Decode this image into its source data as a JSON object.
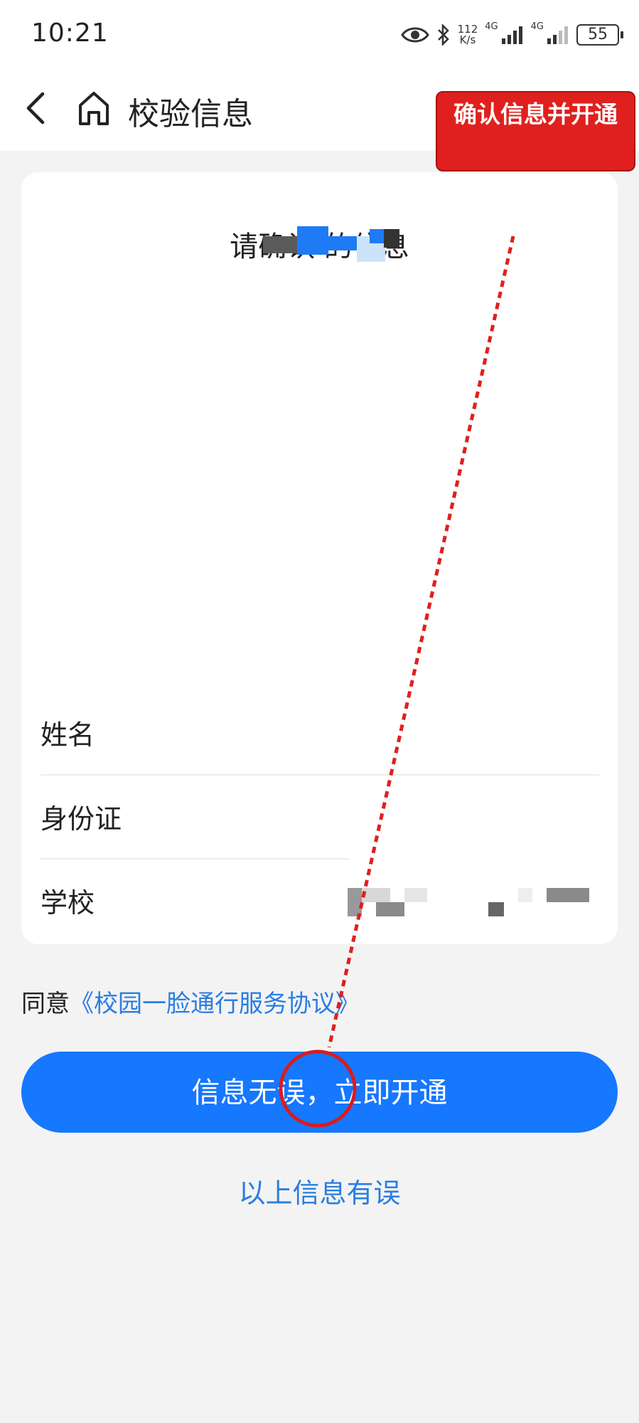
{
  "status_bar": {
    "time": "10:21",
    "speed_value": "112",
    "speed_unit": "K/s",
    "net1": "4G",
    "net2": "4G",
    "battery": "55"
  },
  "nav": {
    "title": "校验信息",
    "back_icon": "chevron-left-icon",
    "home_icon": "home-icon"
  },
  "card": {
    "title": "请确认 的信息",
    "rows": [
      {
        "label": "姓名"
      },
      {
        "label": "身份证"
      },
      {
        "label": "学校"
      }
    ]
  },
  "agreement": {
    "prefix": "同意",
    "link": "《校园一脸通行服务协议》"
  },
  "actions": {
    "confirm_button": "信息无误，立即开通",
    "error_link": "以上信息有误"
  },
  "annotation": {
    "label": "确认信息并开通"
  },
  "colors": {
    "primary": "#1677ff",
    "link": "#2a7de1",
    "annotation_red": "#e0201e",
    "background": "#f3f3f3"
  }
}
